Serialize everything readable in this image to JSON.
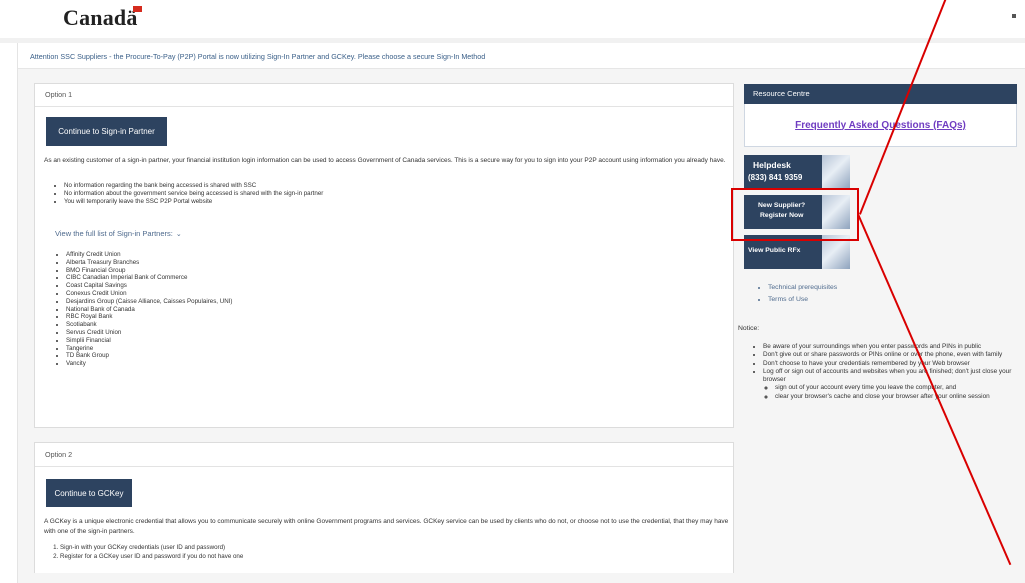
{
  "header": {
    "logo": "Canadä"
  },
  "attention": "Attention SSC Suppliers - the Procure-To-Pay (P2P) Portal is now utilizing Sign-In Partner and GCKey. Please choose a secure Sign-In Method",
  "option1": {
    "title": "Option 1",
    "button": "Continue to Sign-in Partner",
    "para": "As an existing customer of a sign-in partner, your financial institution login information can be used to access Government of Canada services.  This is a secure way for you to sign into your P2P account using information you already have.",
    "bullets": [
      "No information regarding the bank being accessed is shared with SSC",
      "No information about the government service being accessed is shared with the sign-in partner",
      "You will temporarily leave the SSC P2P Portal website"
    ],
    "view_link": "View the full list of Sign-in Partners:",
    "partners": [
      "Affinity Credit Union",
      "Alberta Treasury Branches",
      "BMO Financial Group",
      "CIBC Canadian Imperial Bank of Commerce",
      "Coast Capital Savings",
      "Conexus Credit Union",
      "Desjardins Group (Caisse Alliance, Caisses Populaires, UNI)",
      "National Bank of Canada",
      "RBC Royal Bank",
      "Scotiabank",
      "Servus Credit Union",
      "Simplii Financial",
      "Tangerine",
      "TD Bank Group",
      "Vancity"
    ]
  },
  "option2": {
    "title": "Option 2",
    "button": "Continue to GCKey",
    "para": "A GCKey is a unique electronic credential that allows you to communicate securely with online Government programs and services.  GCKey service can be used by clients who do not, or choose not to use the credential, that they may have with one of the sign-in partners.",
    "steps": [
      "Sign-in with your GCKey credentials (user ID and password)",
      "Register for a GCKey user ID and password if you do not have one"
    ]
  },
  "resource": {
    "title": "Resource Centre",
    "faq": "Frequently Asked Questions (FAQs)"
  },
  "tiles": {
    "helpdesk_title": "Helpdesk",
    "helpdesk_phone": "(833) 841 9359",
    "register_line1": "New Supplier?",
    "register_line2": "Register Now",
    "rfx": "View Public RFx"
  },
  "links": [
    "Technical prerequisites",
    "Terms of Use"
  ],
  "notice": {
    "label": "Notice:",
    "items": [
      "Be aware of your surroundings when you enter passwords and PINs in public",
      "Don't give out or share passwords or PINs online or over the phone, even with family",
      "Don't choose to have your credentials remembered by your Web browser",
      "Log off or sign out of accounts and websites when you are finished; don't just close your browser"
    ],
    "subitems": [
      "sign out of your account every time you leave the computer, and",
      "clear your browser's cache and close your browser after your online session"
    ]
  },
  "colors": {
    "accent": "#2d4360",
    "highlight": "#d90000",
    "faq_link": "#6f3cc1"
  }
}
